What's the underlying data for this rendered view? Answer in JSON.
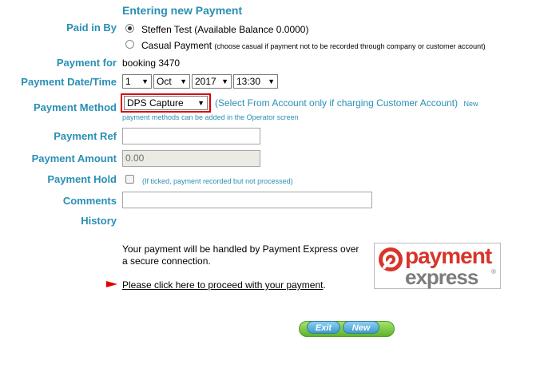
{
  "page": {
    "heading": "Entering new Payment"
  },
  "paid_in_by": {
    "label": "Paid in By",
    "option1": "Steffen Test (Available Balance 0.0000)",
    "option2": "Casual Payment",
    "option2_note": "(choose casual if payment not to be recorded through company or customer account)"
  },
  "payment_for": {
    "label": "Payment for",
    "value": "booking 3470"
  },
  "payment_datetime": {
    "label": "Payment Date/Time",
    "day": "1",
    "month": "Oct",
    "year": "2017",
    "time": "13:30"
  },
  "payment_method": {
    "label": "Payment Method",
    "selected": "DPS Capture",
    "hint": "(Select From Account only if charging Customer Account)",
    "hint_new": "New",
    "hint_line2": "payment methods can be added in the Operator screen"
  },
  "payment_ref": {
    "label": "Payment Ref",
    "value": ""
  },
  "payment_amount": {
    "label": "Payment Amount",
    "value": "0.00"
  },
  "payment_hold": {
    "label": "Payment Hold",
    "hint": "(If ticked, payment recorded but not processed)"
  },
  "comments": {
    "label": "Comments",
    "value": ""
  },
  "history": {
    "label": "History"
  },
  "gateway": {
    "line1": "Your payment will be handled by Payment Express over",
    "line2": "a secure connection.",
    "link": "Please click here to proceed with your payment",
    "link_suffix": ".",
    "logo_word1": "payment",
    "logo_word2": "express",
    "logo_mark": "®"
  },
  "buttons": {
    "exit": "Exit",
    "new": "New"
  },
  "colors": {
    "label": "#2a8fb5",
    "logo_red": "#d8352a",
    "logo_grey": "#7c7c7c",
    "highlight": "#e00000"
  }
}
